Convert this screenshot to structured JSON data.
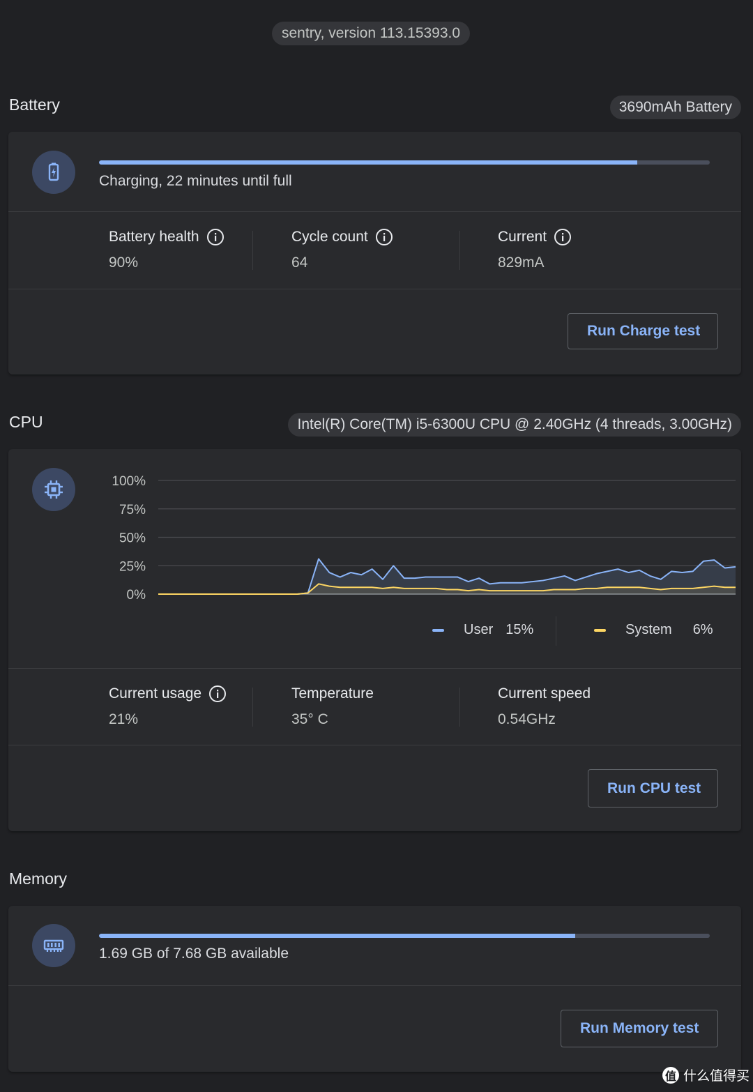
{
  "version": "sentry, version 113.15393.0",
  "battery": {
    "title": "Battery",
    "capacity_chip": "3690mAh Battery",
    "charge_fraction": 0.881,
    "status": "Charging, 22 minutes until full",
    "stats": [
      {
        "label": "Battery health",
        "value": "90%"
      },
      {
        "label": "Cycle count",
        "value": "64"
      },
      {
        "label": "Current",
        "value": "829mA"
      }
    ],
    "button": "Run Charge test"
  },
  "cpu": {
    "title": "CPU",
    "model_chip": "Intel(R) Core(TM) i5-6300U CPU @ 2.40GHz (4 threads, 3.00GHz)",
    "legend": [
      {
        "name": "User",
        "value": "15%",
        "color": "#8ab4f8"
      },
      {
        "name": "System",
        "value": "6%",
        "color": "#fdd663"
      }
    ],
    "stats": [
      {
        "label": "Current usage",
        "value": "21%"
      },
      {
        "label": "Temperature",
        "value": "35° C"
      },
      {
        "label": "Current speed",
        "value": "0.54GHz"
      }
    ],
    "button": "Run CPU test"
  },
  "memory": {
    "title": "Memory",
    "used_fraction": 0.78,
    "status": "1.69 GB of 7.68 GB available",
    "button": "Run Memory test"
  },
  "watermark": {
    "badge": "值",
    "text": "什么值得买"
  },
  "chart_data": {
    "type": "area",
    "ylim": [
      0,
      100
    ],
    "yticks": [
      "100%",
      "75%",
      "50%",
      "25%",
      "0%"
    ],
    "x": [
      0,
      1,
      2,
      3,
      4,
      5,
      6,
      7,
      8,
      9,
      10,
      11,
      12,
      13,
      14,
      15,
      16,
      17,
      18,
      19,
      20,
      21,
      22,
      23,
      24,
      25,
      26,
      27,
      28,
      29,
      30,
      31,
      32,
      33,
      34,
      35,
      36,
      37,
      38,
      39,
      40,
      41,
      42,
      43,
      44,
      45,
      46,
      47,
      48,
      49,
      50
    ],
    "series": [
      {
        "name": "User",
        "color": "#8ab4f8",
        "values": [
          0,
          0,
          0,
          0,
          0,
          0,
          0,
          0,
          0,
          0,
          0,
          0,
          0,
          0,
          1,
          31,
          19,
          15,
          19,
          17,
          22,
          13,
          25,
          14,
          14,
          15,
          15,
          15,
          15,
          11,
          14,
          9,
          10,
          10,
          10,
          11,
          12,
          14,
          16,
          12,
          15,
          18,
          20,
          22,
          19,
          21,
          16,
          13,
          20,
          19,
          20,
          29,
          30,
          23,
          24
        ]
      },
      {
        "name": "System",
        "color": "#fdd663",
        "values": [
          0,
          0,
          0,
          0,
          0,
          0,
          0,
          0,
          0,
          0,
          0,
          0,
          0,
          0,
          1,
          9,
          7,
          6,
          6,
          6,
          6,
          5,
          6,
          5,
          5,
          5,
          5,
          4,
          4,
          3,
          4,
          3,
          3,
          3,
          3,
          3,
          3,
          4,
          4,
          4,
          5,
          5,
          6,
          6,
          6,
          6,
          5,
          4,
          5,
          5,
          5,
          6,
          7,
          6,
          6
        ]
      }
    ]
  }
}
